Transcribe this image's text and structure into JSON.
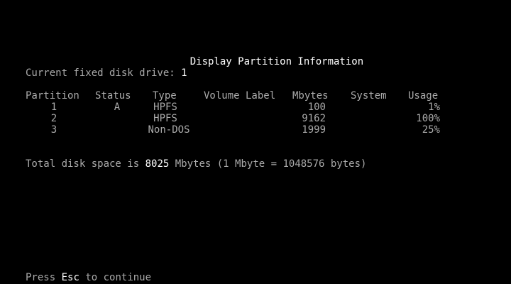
{
  "screen": {
    "title": "Display Partition Information",
    "current_drive_label": "Current fixed disk drive:",
    "current_drive_value": "1",
    "table": {
      "headers": [
        "Partition",
        "Status",
        "Type",
        "Volume Label",
        "Mbytes",
        "System",
        "Usage"
      ],
      "rows": [
        {
          "partition": "1",
          "status": "A",
          "type": "HPFS",
          "volume_label": "",
          "mbytes": "100",
          "system": "",
          "usage": "1%"
        },
        {
          "partition": "2",
          "status": "",
          "type": "HPFS",
          "volume_label": "",
          "mbytes": "9162",
          "system": "",
          "usage": "100%"
        },
        {
          "partition": "3",
          "status": "",
          "type": "Non-DOS",
          "volume_label": "",
          "mbytes": "1999",
          "system": "",
          "usage": "25%"
        }
      ]
    },
    "total_prefix": "Total disk space is",
    "total_value": "8025",
    "total_suffix": "Mbytes (1 Mbyte = 1048576 bytes)",
    "footer_prefix": "Press",
    "footer_key": "Esc",
    "footer_suffix": "to continue"
  },
  "colors": {
    "background": "#000000",
    "text": "#aaaaaa",
    "highlight": "#ffffff"
  }
}
